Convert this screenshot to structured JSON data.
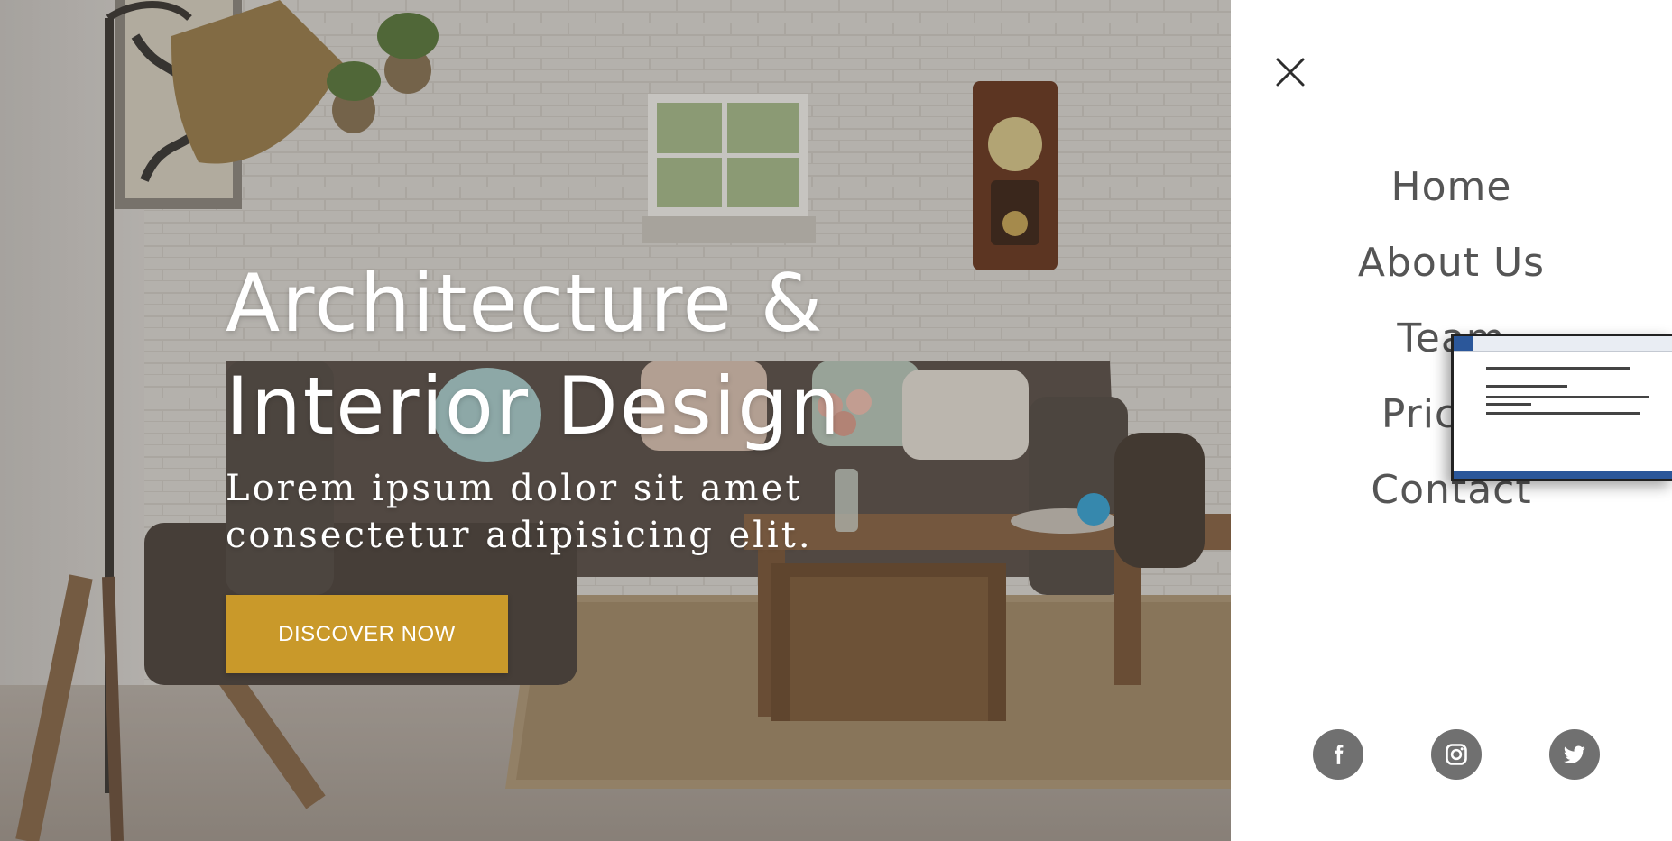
{
  "hero": {
    "title_line1": "Architecture &",
    "title_line2": "Interior Design",
    "subtitle": "Lorem ipsum dolor sit amet consectetur adipisicing elit.",
    "cta_label": "DISCOVER NOW",
    "accent_color": "#c9992a"
  },
  "menu": {
    "close_icon": "close-icon",
    "items": [
      {
        "label": "Home"
      },
      {
        "label": "About Us"
      },
      {
        "label": "Team"
      },
      {
        "label": "Pricing"
      },
      {
        "label": "Contact"
      }
    ],
    "social": [
      {
        "icon": "facebook-icon"
      },
      {
        "icon": "instagram-icon"
      },
      {
        "icon": "twitter-icon"
      }
    ],
    "text_color": "#555555",
    "social_color": "#707070"
  }
}
